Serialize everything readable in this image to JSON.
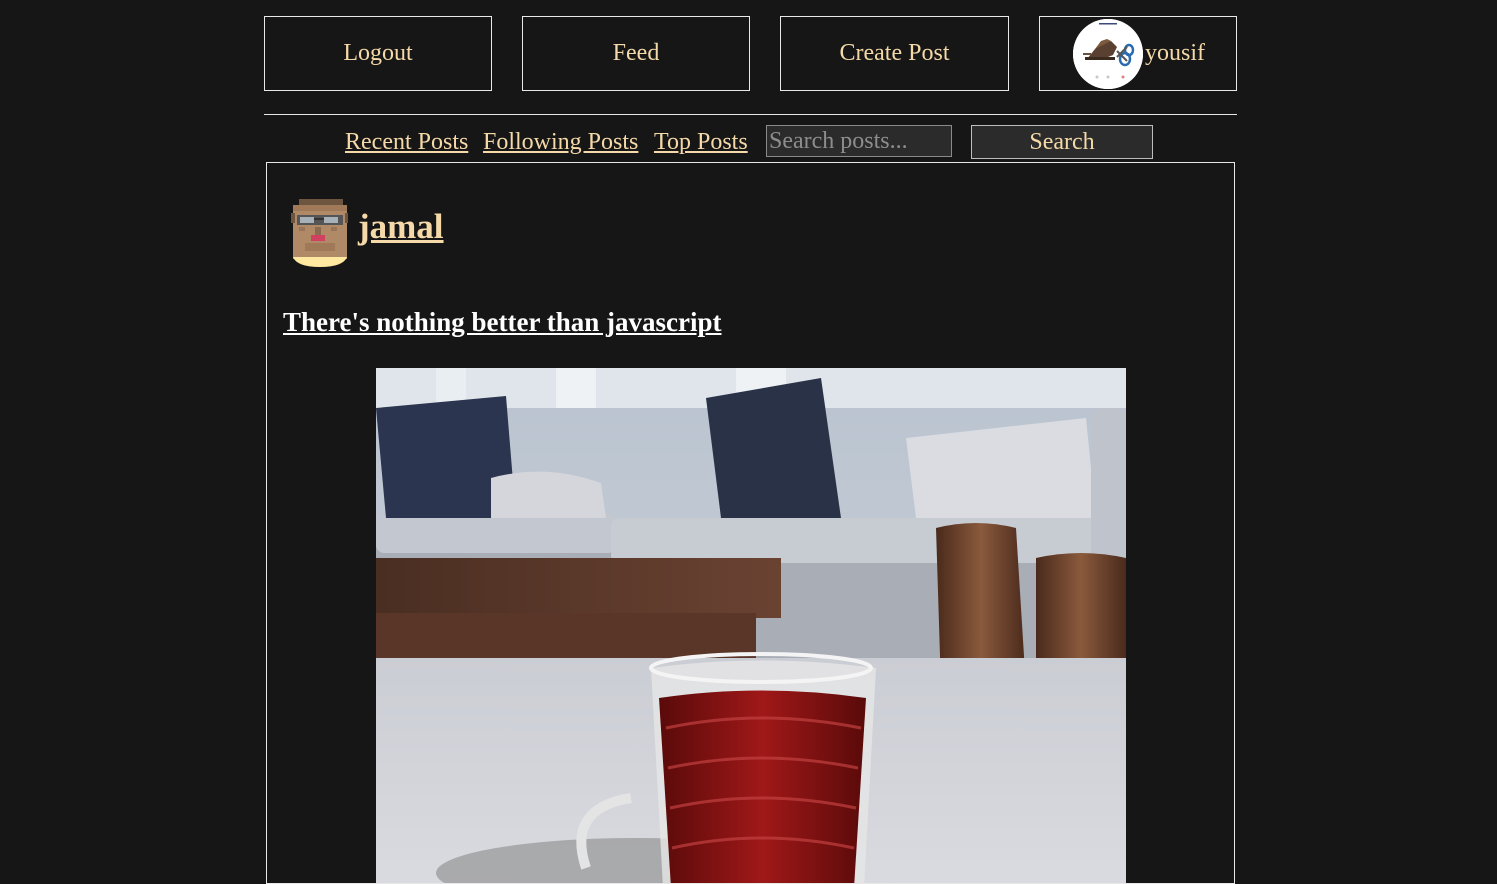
{
  "nav": {
    "logout_label": "Logout",
    "feed_label": "Feed",
    "create_post_label": "Create Post",
    "profile_username": "yousif"
  },
  "filters": {
    "recent_label": "Recent Posts",
    "following_label": "Following Posts",
    "top_label": "Top Posts"
  },
  "search": {
    "placeholder": "Search posts...",
    "value": "",
    "button_label": "Search"
  },
  "post": {
    "author": "jamal",
    "title": "There's nothing better than javascript"
  },
  "colors": {
    "background": "#161616",
    "accent": "#f5d9a8",
    "border": "#e8e8e8"
  }
}
